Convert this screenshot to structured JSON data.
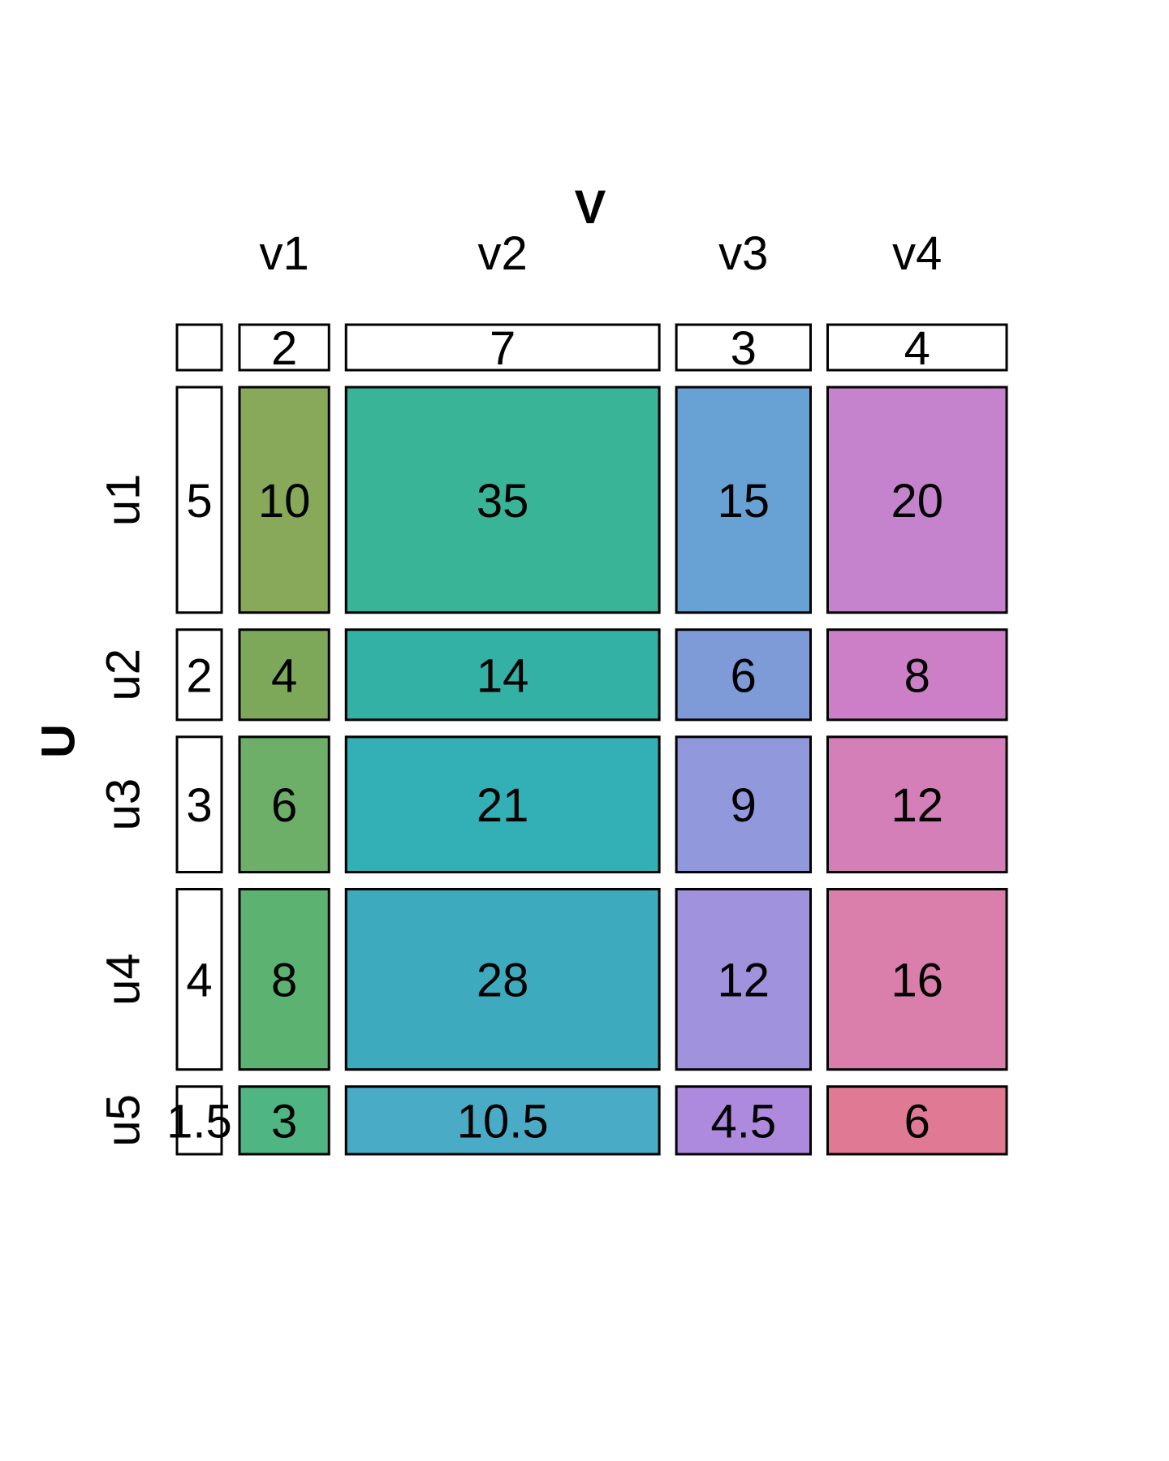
{
  "chart_data": {
    "type": "mosaic",
    "col_var": "V",
    "row_var": "U",
    "columns": [
      "v1",
      "v2",
      "v3",
      "v4"
    ],
    "rows": [
      "u1",
      "u2",
      "u3",
      "u4",
      "u5"
    ],
    "col_margins": [
      2,
      7,
      3,
      4
    ],
    "col_margin_labels": [
      "2",
      "7",
      "3",
      "4"
    ],
    "row_margins": [
      5,
      2,
      3,
      4,
      1.5
    ],
    "row_margin_labels": [
      "5",
      "2",
      "3",
      "4",
      "1.5"
    ],
    "values": [
      [
        10,
        35,
        15,
        20
      ],
      [
        4,
        14,
        6,
        8
      ],
      [
        6,
        21,
        9,
        12
      ],
      [
        8,
        28,
        12,
        16
      ],
      [
        3,
        10.5,
        4.5,
        6
      ]
    ],
    "value_labels": [
      [
        "10",
        "35",
        "15",
        "20"
      ],
      [
        "4",
        "14",
        "6",
        "8"
      ],
      [
        "6",
        "21",
        "9",
        "12"
      ],
      [
        "8",
        "28",
        "12",
        "16"
      ],
      [
        "3",
        "10.5",
        "4.5",
        "6"
      ]
    ],
    "colors": [
      [
        "#88a95a",
        "#3ab497",
        "#68a2d4",
        "#c583cd"
      ],
      [
        "#7da859",
        "#33b1a4",
        "#7e9bd7",
        "#cc7fc6"
      ],
      [
        "#6daf68",
        "#33b0b5",
        "#9199dc",
        "#d47fb7"
      ],
      [
        "#5bb271",
        "#3dabbd",
        "#a192dd",
        "#da7eac"
      ],
      [
        "#4fb583",
        "#49abc6",
        "#ae8ade",
        "#e07a94"
      ]
    ],
    "margin_fill": "#ffffff",
    "stroke_color": "#000000"
  }
}
